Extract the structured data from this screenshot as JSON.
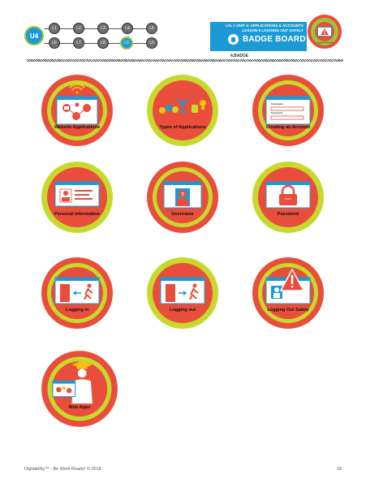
{
  "nav": {
    "unit": "U4",
    "lessons": [
      "L1",
      "L2",
      "L3",
      "L4",
      "L5",
      "L6",
      "L7",
      "L8",
      "L9",
      "L0"
    ],
    "current_lesson": "L9"
  },
  "header": {
    "line1": "LVL 1 UNIT 4: APPLICATIONS & ACCOUNTS",
    "line2": "LESSON 9 LOGGING OUT SAFELY",
    "board_title": "BADGE BOARD",
    "badge_code": "4.BADGE",
    "mini_badge_label": "Logging Out Safely"
  },
  "badges": [
    {
      "label": "Website Applications",
      "icon": "website-applications-icon"
    },
    {
      "label": "Types of Applications",
      "icon": "types-of-applications-icon"
    },
    {
      "label": "Creating an Account",
      "icon": "creating-account-icon",
      "fields": [
        "Username",
        "Password"
      ]
    },
    {
      "label": "Personal Information",
      "icon": "personal-information-icon"
    },
    {
      "label": "Username",
      "icon": "username-icon"
    },
    {
      "label": "Password",
      "icon": "password-icon"
    },
    {
      "label": "Logging in",
      "icon": "logging-in-icon"
    },
    {
      "label": "Logging out",
      "icon": "logging-out-icon"
    },
    {
      "label": "Logging Out Safely",
      "icon": "logging-out-safely-icon"
    },
    {
      "label": "Web Apps",
      "icon": "web-apps-icon"
    }
  ],
  "colors": {
    "badge_red": "#e84e3b",
    "badge_green": "#c8d92d",
    "accent_blue": "#1d9ad6"
  },
  "footer": {
    "left": "Digitability™ - Be Work Ready! © 2018",
    "page": "18"
  }
}
